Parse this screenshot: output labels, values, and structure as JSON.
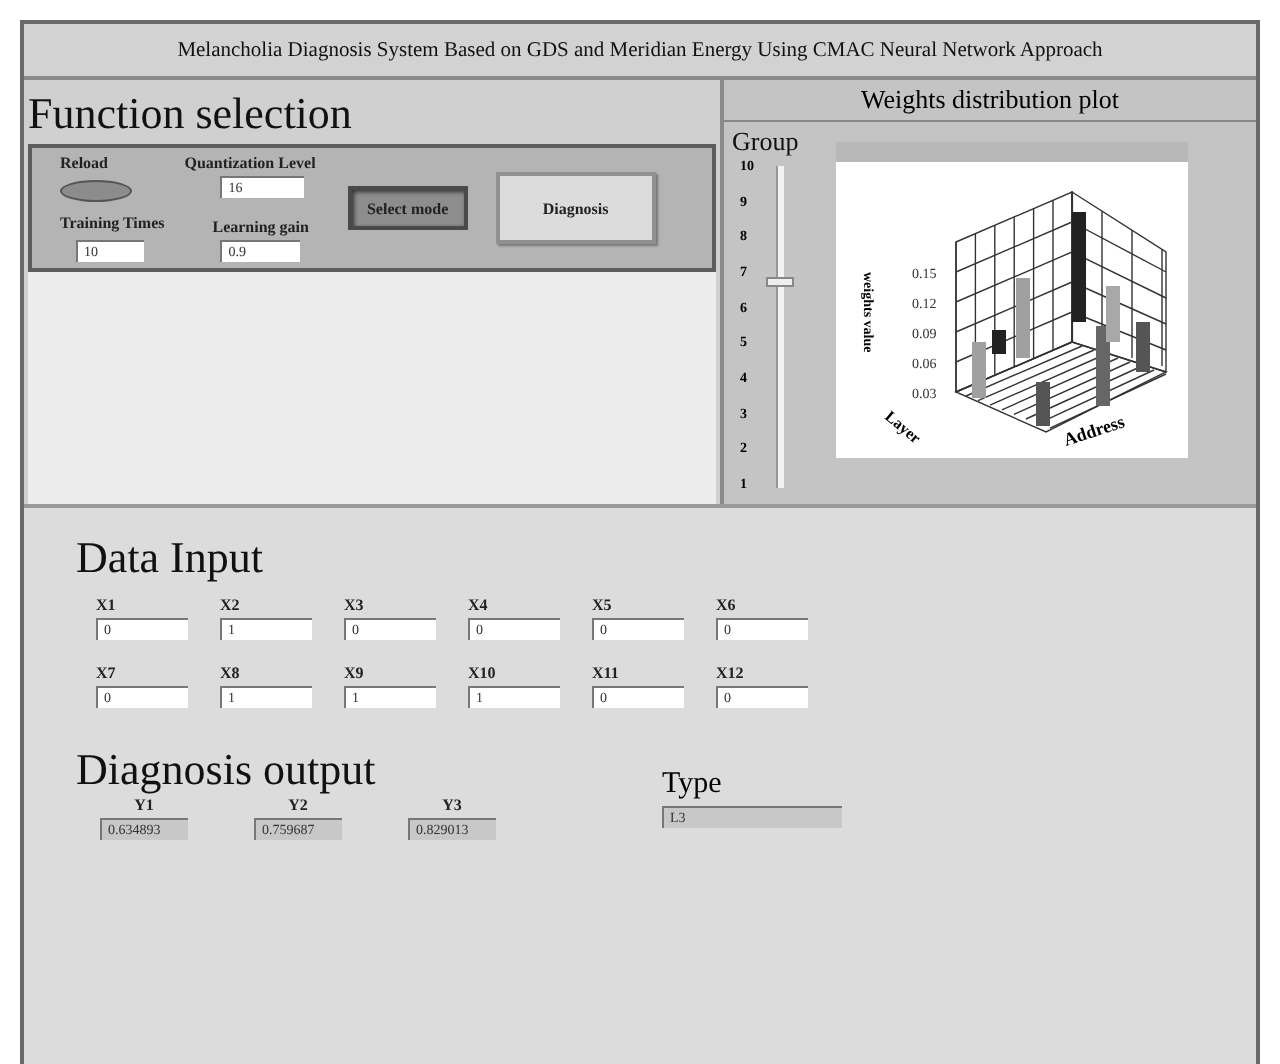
{
  "window": {
    "title": "Melancholia Diagnosis System Based on GDS and Meridian Energy Using CMAC Neural Network Approach"
  },
  "function_selection": {
    "heading": "Function selection",
    "reload": {
      "label": "Reload"
    },
    "fields": [
      {
        "label": "Quantization  Level",
        "value": "16"
      },
      {
        "label": "Training Times",
        "value": "10"
      },
      {
        "label": "Learning gain",
        "value": "0.9"
      }
    ],
    "buttons": [
      {
        "label": "Select mode",
        "pressed": true
      },
      {
        "label": "Diagnosis",
        "pressed": false
      }
    ]
  },
  "weights_plot": {
    "title": "Weights distribution plot",
    "slider": {
      "label": "Group",
      "ticks": [
        "10",
        "9",
        "8",
        "7",
        "6",
        "5",
        "4",
        "3",
        "2",
        "1"
      ],
      "level": 0.667
    },
    "yticks": [
      "0.15",
      "0.12",
      "0.09",
      "0.06",
      "0.03"
    ],
    "ylabel": "weights value",
    "xlabel": "Address",
    "zlabel": "Layer"
  },
  "data_input": {
    "heading": "Data Input",
    "fields": [
      {
        "label": "X1",
        "value": "0"
      },
      {
        "label": "X2",
        "value": "1"
      },
      {
        "label": "X3",
        "value": "0"
      },
      {
        "label": "X4",
        "value": "0"
      },
      {
        "label": "X5",
        "value": "0"
      },
      {
        "label": "X6",
        "value": "0"
      },
      {
        "label": "X7",
        "value": "0"
      },
      {
        "label": "X8",
        "value": "1"
      },
      {
        "label": "X9",
        "value": "1"
      },
      {
        "label": "X10",
        "value": "1"
      },
      {
        "label": "X11",
        "value": "0"
      },
      {
        "label": "X12",
        "value": "0"
      }
    ]
  },
  "diagnosis_output": {
    "heading": "Diagnosis output",
    "fields": [
      {
        "label": "Y1",
        "value": "0.634893"
      },
      {
        "label": "Y2",
        "value": "0.759687"
      },
      {
        "label": "Y3",
        "value": "0.829013"
      }
    ],
    "type": {
      "label": "Type",
      "value": "L3"
    }
  }
}
